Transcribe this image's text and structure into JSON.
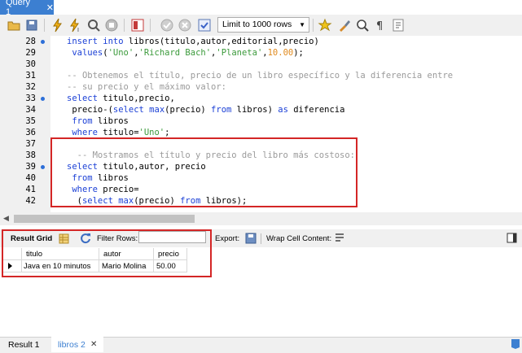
{
  "tabs": {
    "query_tab": "Query 1",
    "close": "✕"
  },
  "toolbar": {
    "limit_label": "Limit to 1000 rows"
  },
  "editor": {
    "lines": [
      {
        "n": "28",
        "dot": true
      },
      {
        "n": "29",
        "dot": false
      },
      {
        "n": "30",
        "dot": false
      },
      {
        "n": "31",
        "dot": false
      },
      {
        "n": "32",
        "dot": false
      },
      {
        "n": "33",
        "dot": true
      },
      {
        "n": "34",
        "dot": false
      },
      {
        "n": "35",
        "dot": false
      },
      {
        "n": "36",
        "dot": false
      },
      {
        "n": "37",
        "dot": false
      },
      {
        "n": "38",
        "dot": false
      },
      {
        "n": "39",
        "dot": true
      },
      {
        "n": "40",
        "dot": false
      },
      {
        "n": "41",
        "dot": false
      },
      {
        "n": "42",
        "dot": false
      }
    ],
    "code": {
      "l28": [
        "insert",
        " ",
        "into",
        " libros(titulo,autor,editorial,precio)"
      ],
      "l29": [
        " ",
        "values",
        "(",
        "'Uno'",
        ",",
        "'Richard Bach'",
        ",",
        "'Planeta'",
        ",",
        "10.00",
        ");"
      ],
      "l31": "-- Obtenemos el título, precio de un libro específico y la diferencia entre",
      "l32": "-- su precio y el máximo valor:",
      "l33": [
        "select",
        " titulo,precio,"
      ],
      "l34": [
        " precio-(",
        "select",
        " ",
        "max",
        "(precio) ",
        "from",
        " libros) ",
        "as",
        " diferencia"
      ],
      "l35": [
        " ",
        "from",
        " libros"
      ],
      "l36": [
        " ",
        "where",
        " titulo=",
        "'Uno'",
        ";"
      ],
      "l38": "  -- Mostramos el título y precio del libro más costoso:",
      "l39": [
        "select",
        " titulo,autor, precio"
      ],
      "l40": [
        " ",
        "from",
        " libros"
      ],
      "l41": [
        " ",
        "where",
        " precio="
      ],
      "l42": [
        "  (",
        "select",
        " ",
        "max",
        "(precio) ",
        "from",
        " libros);"
      ]
    }
  },
  "result_toolbar": {
    "result_grid": "Result Grid",
    "filter_rows": "Filter Rows:",
    "export": "Export:",
    "wrap_cell": "Wrap Cell Content:"
  },
  "grid": {
    "columns": [
      "titulo",
      "autor",
      "precio"
    ],
    "rows": [
      [
        "Java en 10 minutos",
        "Mario Molina",
        "50.00"
      ]
    ]
  },
  "bottom_tabs": {
    "result1": "Result 1",
    "libros2": "libros 2",
    "close": "✕"
  }
}
